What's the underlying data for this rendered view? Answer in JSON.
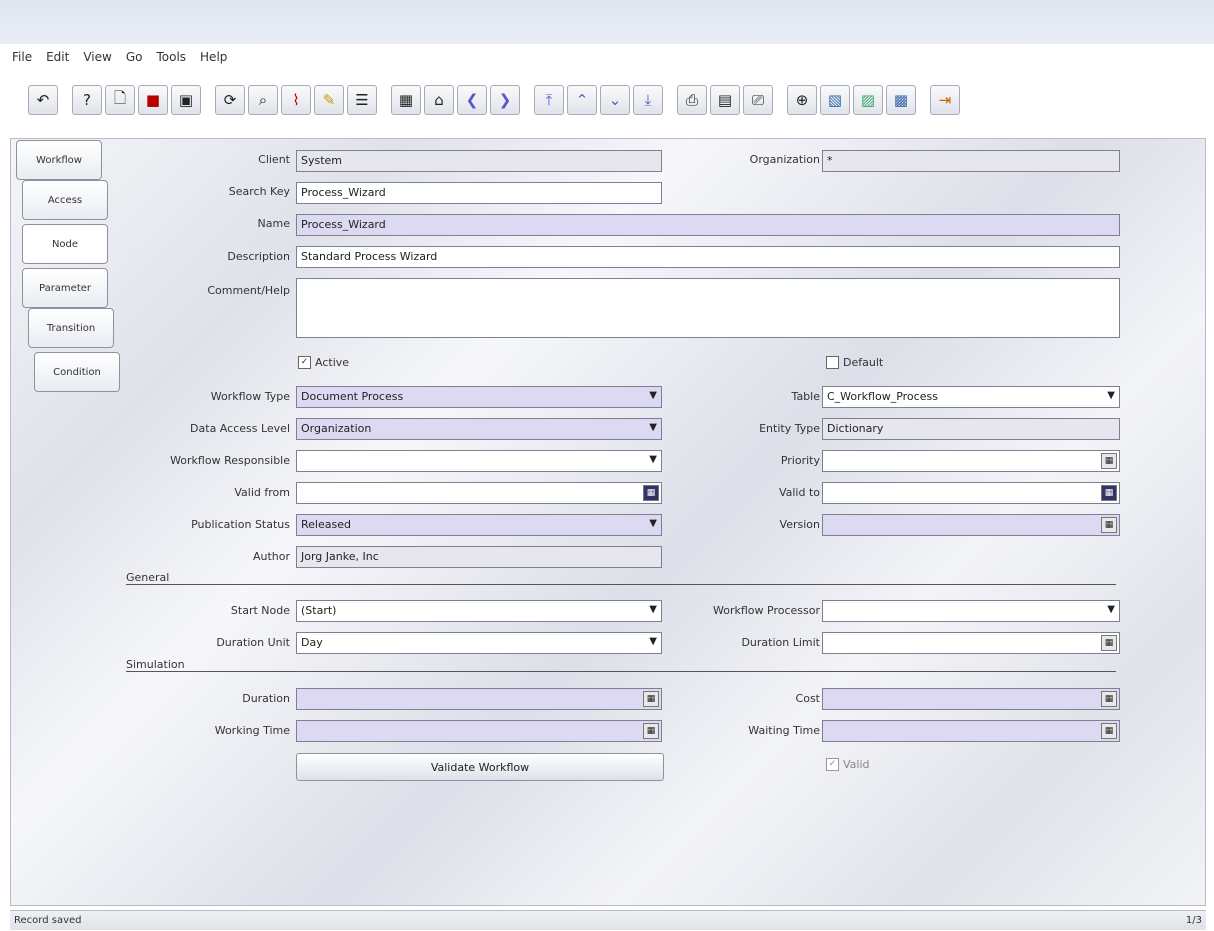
{
  "menu": [
    "File",
    "Edit",
    "View",
    "Go",
    "Tools",
    "Help"
  ],
  "toolbar_icons": [
    "undo-icon",
    "help-icon",
    "new-icon",
    "delete-icon",
    "save-icon",
    "refresh-icon",
    "find-icon",
    "attachment-icon",
    "chat-icon",
    "history-icon",
    "grid-toggle-icon",
    "parent-icon",
    "previous-icon",
    "next-icon",
    "first-icon",
    "up-icon",
    "down-icon",
    "last-icon",
    "report-icon",
    "archive-icon",
    "print-icon",
    "zoom-icon",
    "workflow-icon",
    "request-icon",
    "product-icon",
    "exit-icon"
  ],
  "tabs": [
    "Workflow",
    "Access",
    "Node",
    "Parameter",
    "Transition",
    "Condition"
  ],
  "form": {
    "client_label": "Client",
    "client_value": "System",
    "org_label": "Organization",
    "org_value": "*",
    "search_key_label": "Search Key",
    "search_key_value": "Process_Wizard",
    "name_label": "Name",
    "name_value": "Process_Wizard",
    "description_label": "Description",
    "description_value": "Standard Process Wizard",
    "comment_label": "Comment/Help",
    "comment_value": "",
    "active_label": "Active",
    "active_checked": true,
    "default_label": "Default",
    "default_checked": false,
    "workflow_type_label": "Workflow Type",
    "workflow_type_value": "Document Process",
    "table_label": "Table",
    "table_value": "C_Workflow_Process",
    "data_access_label": "Data Access Level",
    "data_access_value": "Organization",
    "entity_type_label": "Entity Type",
    "entity_type_value": "Dictionary",
    "responsible_label": "Workflow Responsible",
    "responsible_value": "",
    "priority_label": "Priority",
    "priority_value": "",
    "valid_from_label": "Valid from",
    "valid_from_value": "",
    "valid_to_label": "Valid to",
    "valid_to_value": "",
    "publication_label": "Publication Status",
    "publication_value": "Released",
    "version_label": "Version",
    "version_value": "",
    "author_label": "Author",
    "author_value": "Jorg Janke, Inc",
    "general_section": "General",
    "start_node_label": "Start Node",
    "start_node_value": "(Start)",
    "wf_processor_label": "Workflow Processor",
    "wf_processor_value": "",
    "duration_unit_label": "Duration Unit",
    "duration_unit_value": "Day",
    "duration_limit_label": "Duration Limit",
    "duration_limit_value": "",
    "simulation_section": "Simulation",
    "duration_label": "Duration",
    "duration_value": "",
    "cost_label": "Cost",
    "cost_value": "",
    "working_time_label": "Working Time",
    "working_time_value": "",
    "waiting_time_label": "Waiting Time",
    "waiting_time_value": "",
    "validate_button": "Validate Workflow",
    "valid_label": "Valid",
    "valid_checked": true
  },
  "status": {
    "left": "Record saved",
    "right": "1/3"
  }
}
